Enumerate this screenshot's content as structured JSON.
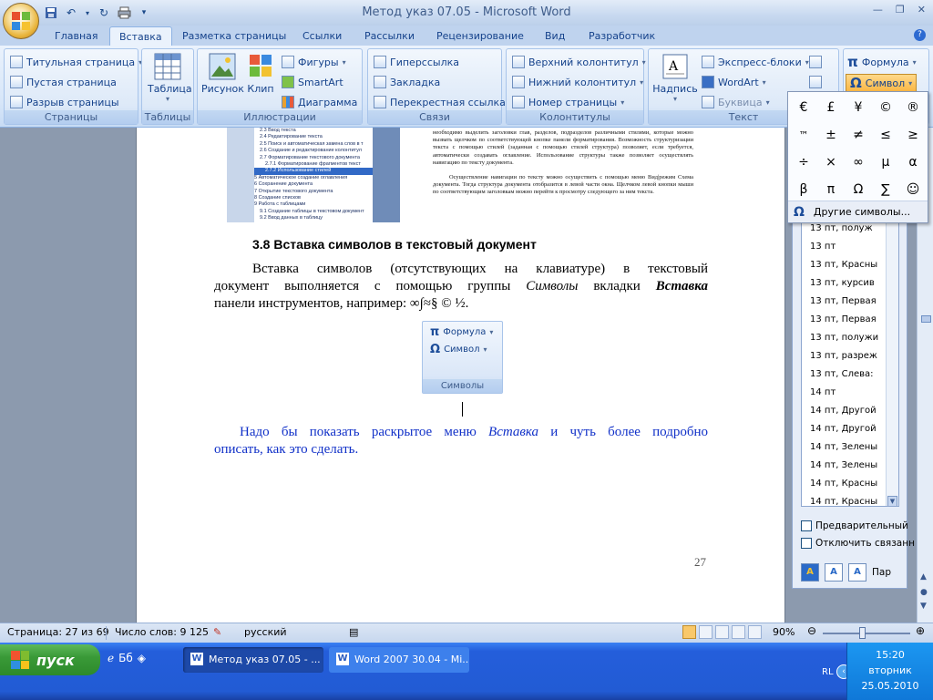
{
  "window": {
    "title": "Метод указ 07.05 - Microsoft Word"
  },
  "qat": {
    "icons": [
      "save-icon",
      "undo-icon",
      "redo-icon",
      "print-icon"
    ]
  },
  "tabs": [
    "Главная",
    "Вставка",
    "Разметка страницы",
    "Ссылки",
    "Рассылки",
    "Рецензирование",
    "Вид",
    "Разработчик"
  ],
  "ribbon": {
    "pages": {
      "label": "Страницы",
      "items": [
        "Титульная страница",
        "Пустая страница",
        "Разрыв страницы"
      ]
    },
    "tables": {
      "label": "Таблицы",
      "item": "Таблица"
    },
    "illustrations": {
      "label": "Иллюстрации",
      "picture": "Рисунок",
      "clip": "Клип",
      "shapes": "Фигуры",
      "smartart": "SmartArt",
      "chart": "Диаграмма"
    },
    "links": {
      "label": "Связи",
      "items": [
        "Гиперссылка",
        "Закладка",
        "Перекрестная ссылка"
      ]
    },
    "headers": {
      "label": "Колонтитулы",
      "items": [
        "Верхний колонтитул",
        "Нижний колонтитул",
        "Номер страницы"
      ]
    },
    "text": {
      "label": "Текст",
      "textbox": "Надпись",
      "express": "Экспресс-блоки",
      "wordart": "WordArt",
      "dropcap": "Буквица"
    },
    "symbols": {
      "formula": "Формула",
      "symbol": "Символ"
    }
  },
  "symbol_menu": {
    "symbols": [
      "€",
      "£",
      "¥",
      "©",
      "®",
      "™",
      "±",
      "≠",
      "≤",
      "≥",
      "÷",
      "×",
      "∞",
      "µ",
      "α",
      "β",
      "π",
      "Ω",
      "∑",
      "☺"
    ],
    "more": "Другие символы..."
  },
  "document": {
    "toc_lines": [
      "2.3 Ввод текста",
      "2.4 Редактирование текста",
      "2.5 Поиск и автоматическая замена слов в т",
      "2.6 Создание и редактирование колонтитул",
      "2.7 Форматирование текстового документа",
      "2.7.1 Форматирование  фрагментов текст",
      "2.7.2 Использование стилей",
      "5 Автоматическое создание оглавления",
      "6 Сохранение документа",
      "7 Открытие текстового документа",
      "8 Создание списков",
      "9 Работа с таблицами",
      "9.1 Создание таблицы в текстовом документ",
      "9.2 Ввод данных в таблицу"
    ],
    "right_para1": "необходимо выделить заголовки глав, разделов, подразделов различными стилями, которые можно вызвать щелчком по соответствующей кнопке панели форматирования. Возможность структуризации текста с помощью стилей (заданная с помощью стилей структура) позволяет, если требуется, автоматически создавать оглавление. Использование структуры также позволяет осуществлять навигацию по тексту документа.",
    "right_para2": "Осуществление навигации по тексту можно осуществить с помощью меню Вид|режим Схема документа. Тогда структура документа отобразится в левой части окна. Щелчком левой кнопки мыши по соответствующим заголовкам можно перейти к просмотру следующего за ним  текста.",
    "heading": "3.8 Вставка символов в текстовый документ",
    "para_line1": "Вставка символов (отсутствующих на клавиатуре) в текстовый",
    "para_line2_a": "документ выполняется с помощью группы ",
    "para_line2_b": "Символы",
    "para_line2_c": " вкладки ",
    "para_line2_d": "Вставка",
    "para_line3": "панели инструментов, например: ∞∫≈§ © ½.",
    "mini_formula": "Формула",
    "mini_symbol": "Символ",
    "mini_label": "Символы",
    "note_line1_a": "Надо бы показать раскрытое меню ",
    "note_line1_b": "Вставка",
    "note_line1_c": " и чуть более подробно",
    "note_line2": "описать, как это сделать.",
    "page_number": "27"
  },
  "styles_pane": {
    "items": [
      "13 пт, полуж",
      "13 пт",
      "13 пт, Красны",
      "13 пт, курсив",
      "13 пт, Первая",
      "13 пт, Первая",
      "13 пт, полужи",
      "13 пт, разреж",
      "13 пт, Слева:",
      "14 пт",
      "14 пт, Другой",
      "14 пт, Другой",
      "14 пт, Зелены",
      "14 пт, Зелены",
      "14 пт, Красны",
      "14 пт, Красны"
    ],
    "preview_label": "Предварительный",
    "disable_label": "Отключить связанн",
    "params": "Пар"
  },
  "status": {
    "page": "Страница: 27 из 69",
    "words": "Число слов: 9 125",
    "lang": "русский",
    "zoom": "90%"
  },
  "taskbar": {
    "start": "пуск",
    "tasks": [
      "Метод указ 07.05 - ...",
      "Word 2007 30.04 - Mi..."
    ],
    "lang": "RL",
    "time": "15:20",
    "day": "вторник",
    "date": "25.05.2010"
  }
}
